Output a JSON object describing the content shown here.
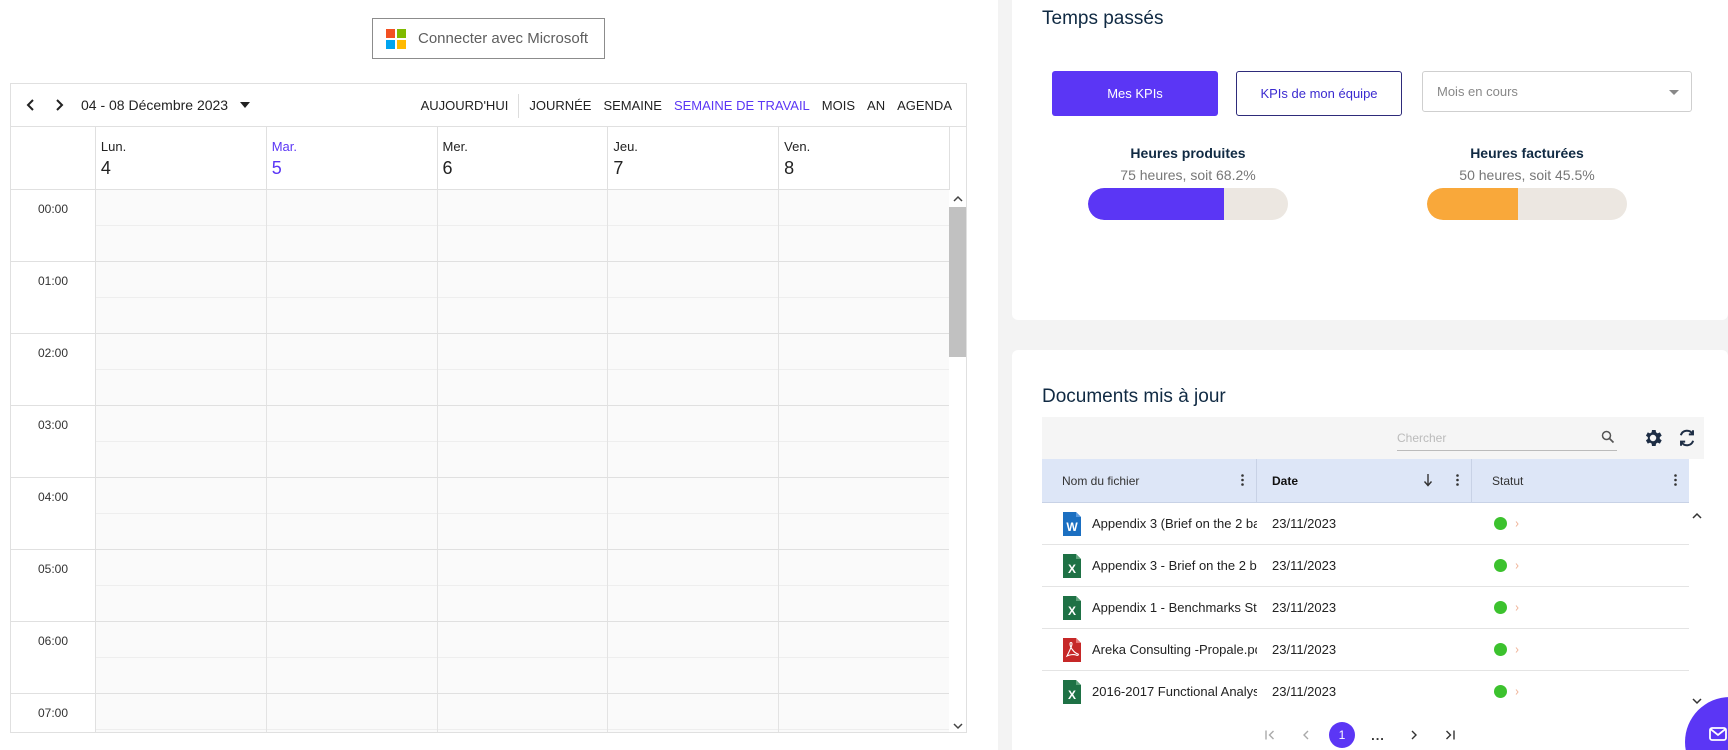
{
  "microsoft": {
    "label": "Connecter avec Microsoft",
    "logo_colors": [
      "#f25022",
      "#7fba00",
      "#00a4ef",
      "#ffb900"
    ]
  },
  "calendar": {
    "date_range": "04 - 08 Décembre 2023",
    "views": {
      "today": "AUJOURD'HUI",
      "day": "JOURNÉE",
      "week": "SEMAINE",
      "work_week": "SEMAINE DE TRAVAIL",
      "month": "MOIS",
      "year": "AN",
      "agenda": "AGENDA"
    },
    "active_view": "work_week",
    "days": [
      {
        "name": "Lun.",
        "num": "4"
      },
      {
        "name": "Mar.",
        "num": "5",
        "today": true
      },
      {
        "name": "Mer.",
        "num": "6"
      },
      {
        "name": "Jeu.",
        "num": "7"
      },
      {
        "name": "Ven.",
        "num": "8"
      }
    ],
    "hours": [
      "00:00",
      "01:00",
      "02:00",
      "03:00",
      "04:00",
      "05:00",
      "06:00",
      "07:00"
    ]
  },
  "time_card": {
    "title": "Temps passés",
    "tab_mine": "Mes KPIs",
    "tab_team": "KPIs de mon équipe",
    "period_placeholder": "Mois en cours",
    "kpis": {
      "produced": {
        "label": "Heures produites",
        "sub": "75 heures, soit 68.2%",
        "fraction": 0.682,
        "color": "#5b36f5"
      },
      "billed": {
        "label": "Heures facturées",
        "sub": "50 heures, soit 45.5%",
        "fraction": 0.455,
        "color": "#f9a83a"
      }
    }
  },
  "docs_card": {
    "title": "Documents mis à jour",
    "search_placeholder": "Chercher",
    "columns": {
      "name": "Nom du fichier",
      "date": "Date",
      "status": "Statut"
    },
    "rows": [
      {
        "type": "word",
        "name": "Appendix 3 (Brief on the 2 ba",
        "date": "23/11/2023"
      },
      {
        "type": "excel",
        "name": "Appendix 3 - Brief on the 2 b",
        "date": "23/11/2023"
      },
      {
        "type": "excel",
        "name": "Appendix 1 - Benchmarks St",
        "date": "23/11/2023"
      },
      {
        "type": "pdf",
        "name": "Areka Consulting -Propale.pd",
        "date": "23/11/2023"
      },
      {
        "type": "excel",
        "name": "2016-2017 Functional Analys",
        "date": "23/11/2023"
      }
    ],
    "pager": {
      "current": "1",
      "ellipsis": "..."
    }
  }
}
